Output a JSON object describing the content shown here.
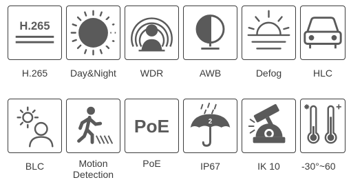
{
  "colors": {
    "icon": "#5a5a5a",
    "dark": "#3a3a3a",
    "border": "#3c3c3c",
    "background": "#ffffff"
  },
  "row1": [
    {
      "icon": "h265-text-icon",
      "icon_text": "H.265",
      "label": "H.265"
    },
    {
      "icon": "sun-moon-icon",
      "label": "Day&Night"
    },
    {
      "icon": "wdr-face-icon",
      "label": "WDR"
    },
    {
      "icon": "half-circle-balance-icon",
      "label": "AWB"
    },
    {
      "icon": "sunrise-fog-icon",
      "label": "Defog"
    },
    {
      "icon": "car-headlight-icon",
      "label": "HLC"
    }
  ],
  "row2": [
    {
      "icon": "sun-person-icon",
      "label": "BLC"
    },
    {
      "icon": "walking-person-icon",
      "label": "Motion\nDetection"
    },
    {
      "icon": "poe-text-icon",
      "icon_text": "PoE",
      "label": "PoE"
    },
    {
      "icon": "umbrella-rain-icon",
      "icon_text": "2",
      "label": "IP67"
    },
    {
      "icon": "hammer-camera-icon",
      "label": "IK 10"
    },
    {
      "icon": "thermometers-icon",
      "label": "-30°~60"
    }
  ]
}
